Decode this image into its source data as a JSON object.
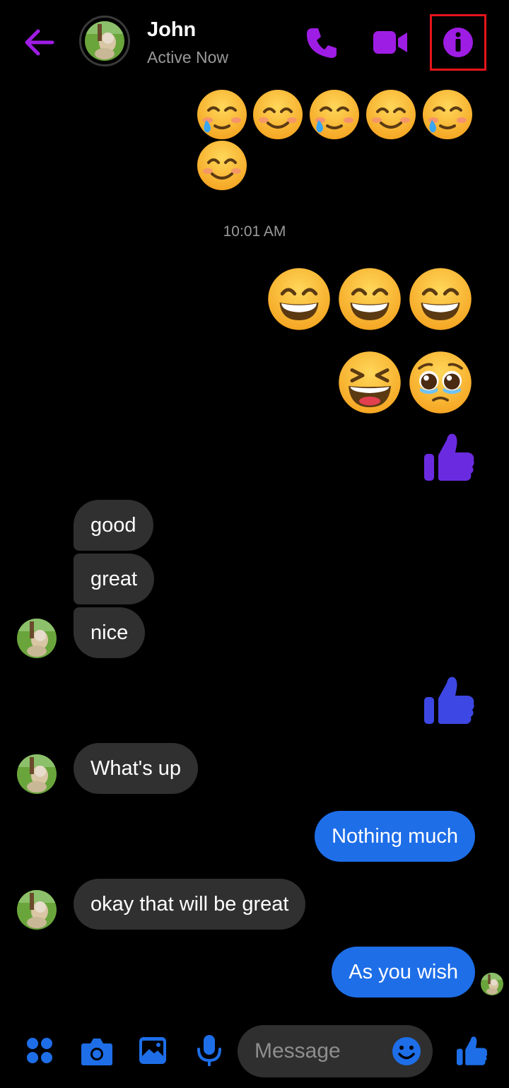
{
  "header": {
    "contact_name": "John",
    "status": "Active Now",
    "icons": [
      "back-arrow-icon",
      "phone-icon",
      "video-camera-icon",
      "info-icon"
    ]
  },
  "messages": {
    "timestamp": "10:01 AM",
    "incoming": [
      "good",
      "great",
      "nice",
      "What's up",
      "okay that will be great"
    ],
    "outgoing": [
      "Nothing much",
      "As you wish"
    ]
  },
  "composer": {
    "placeholder": "Message",
    "icons": [
      "apps-grid-icon",
      "camera-icon",
      "gallery-icon",
      "microphone-icon",
      "emoji-icon",
      "thumbs-up-icon"
    ]
  },
  "colors": {
    "accent_purple": "#9e1de4",
    "bubble_blue": "#1e6ee8",
    "bubble_gray": "#303030",
    "highlight_red": "#e3141b"
  }
}
